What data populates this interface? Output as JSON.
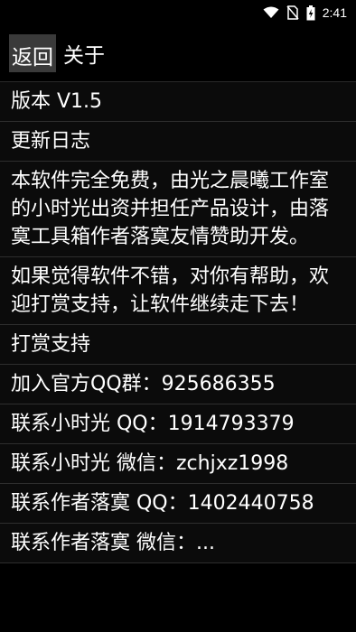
{
  "status_bar": {
    "time": "2:41",
    "icons": [
      "wifi-icon",
      "no-sim-icon",
      "battery-charging-icon"
    ]
  },
  "header": {
    "back_label": "返回",
    "title": "关于"
  },
  "items": [
    {
      "text": "版本 V1.5"
    },
    {
      "text": "更新日志"
    },
    {
      "text": "本软件完全免费，由光之晨曦工作室的小时光出资并担任产品设计，由落寞工具箱作者落寞友情赞助开发。"
    },
    {
      "text": "如果觉得软件不错，对你有帮助，欢迎打赏支持，让软件继续走下去！"
    },
    {
      "text": "打赏支持"
    },
    {
      "text": "加入官方QQ群：925686355"
    },
    {
      "text": "联系小时光 QQ：1914793379"
    },
    {
      "text": "联系小时光 微信：zchjxz1998"
    },
    {
      "text": "联系作者落寞 QQ：1402440758"
    },
    {
      "text": "联系作者落寞 微信：..."
    }
  ]
}
